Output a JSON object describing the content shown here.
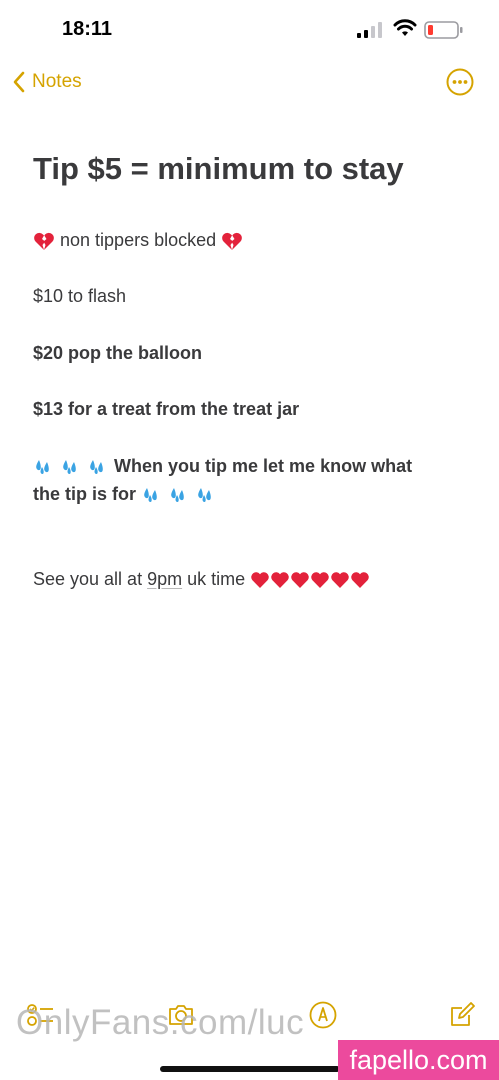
{
  "status_bar": {
    "time": "18:11"
  },
  "nav": {
    "back_label": "Notes"
  },
  "note": {
    "title": "Tip $5 = minimum to stay",
    "line1": "non tippers blocked",
    "line2": "$10 to flash",
    "line3": "$20 pop the balloon",
    "line4": "$13 for a treat from the treat jar",
    "line5a": "When you tip me let me know what",
    "line5b": "the tip is for",
    "line6_prefix": "See you all at ",
    "line6_time": "9pm",
    "line6_suffix": " uk time"
  },
  "watermarks": {
    "left": "OnlyFans.com/luc",
    "badge": "fapello.com"
  },
  "colors": {
    "accent": "#d5a300",
    "text": "#3a3a3c",
    "badge": "#ec4a9d"
  },
  "icons": {
    "back": "chevron-left-icon",
    "more": "more-circle-icon",
    "checklist": "checklist-icon",
    "camera": "camera-icon",
    "markup": "pen-markup-icon",
    "compose": "compose-icon"
  }
}
